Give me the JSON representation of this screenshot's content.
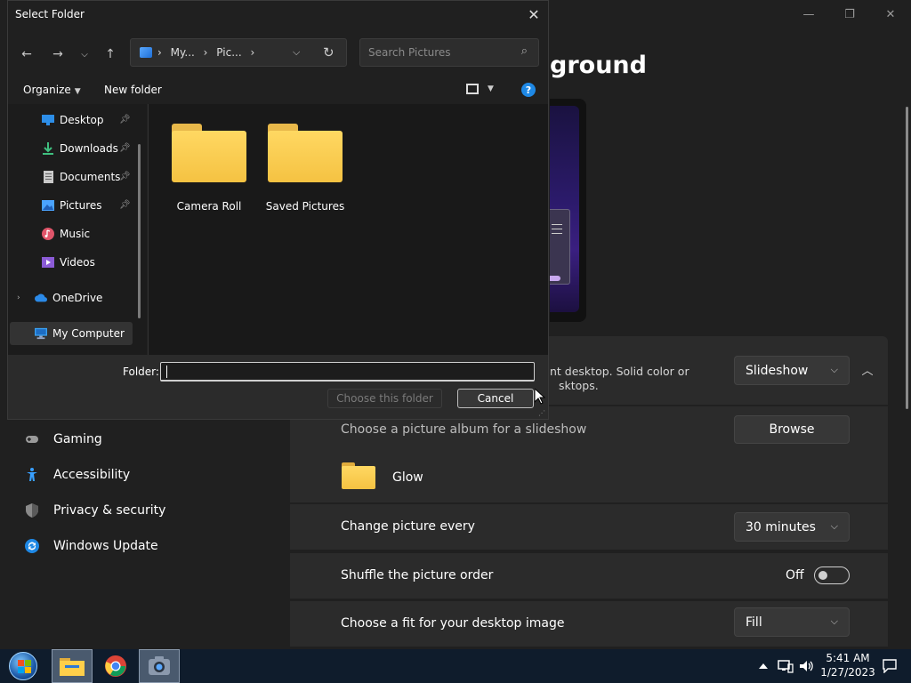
{
  "settings": {
    "title_fragment": "ground",
    "window_controls": {
      "minimize": "—",
      "maximize": "❐",
      "close": "✕"
    },
    "background_card": {
      "description_line1": "nt desktop. Solid color or",
      "description_line2": "sktops.",
      "selected": "Slideshow"
    },
    "album_label": "Choose a picture album for a slideshow",
    "browse_label": "Browse",
    "album_name": "Glow",
    "change_every_label": "Change picture every",
    "change_every_value": "30 minutes",
    "shuffle_label": "Shuffle the picture order",
    "shuffle_state": "Off",
    "fit_label": "Choose a fit for your desktop image",
    "fit_value": "Fill",
    "nav": [
      {
        "label": "Gaming",
        "icon": "gamepad-icon"
      },
      {
        "label": "Accessibility",
        "icon": "accessibility-icon"
      },
      {
        "label": "Privacy & security",
        "icon": "shield-icon"
      },
      {
        "label": "Windows Update",
        "icon": "update-icon"
      }
    ]
  },
  "dialog": {
    "title": "Select Folder",
    "close": "✕",
    "address": {
      "crumb1": "My...",
      "crumb2": "Pic..."
    },
    "search_placeholder": "Search Pictures",
    "toolbar": {
      "organize": "Organize",
      "new_folder": "New folder",
      "help": "?"
    },
    "tree": [
      {
        "label": "Desktop",
        "icon": "desktop-icon",
        "pinned": true
      },
      {
        "label": "Downloads",
        "icon": "download-icon",
        "pinned": true
      },
      {
        "label": "Documents",
        "icon": "document-icon",
        "pinned": true
      },
      {
        "label": "Pictures",
        "icon": "pictures-icon",
        "pinned": true
      },
      {
        "label": "Music",
        "icon": "music-icon",
        "pinned": false
      },
      {
        "label": "Videos",
        "icon": "video-icon",
        "pinned": false
      },
      {
        "label": "OneDrive",
        "icon": "cloud-icon",
        "pinned": false
      },
      {
        "label": "My Computer",
        "icon": "computer-icon",
        "pinned": false
      }
    ],
    "folders": [
      "Camera Roll",
      "Saved Pictures"
    ],
    "folder_label": "Folder:",
    "folder_value": "",
    "choose_label": "Choose this folder",
    "cancel_label": "Cancel"
  },
  "taskbar": {
    "time": "5:41 AM",
    "date": "1/27/2023"
  },
  "colors": {
    "accent": "#1e88e5",
    "folder": "#f5c242",
    "window_bg": "#202020",
    "card_bg": "#2b2b2b"
  }
}
